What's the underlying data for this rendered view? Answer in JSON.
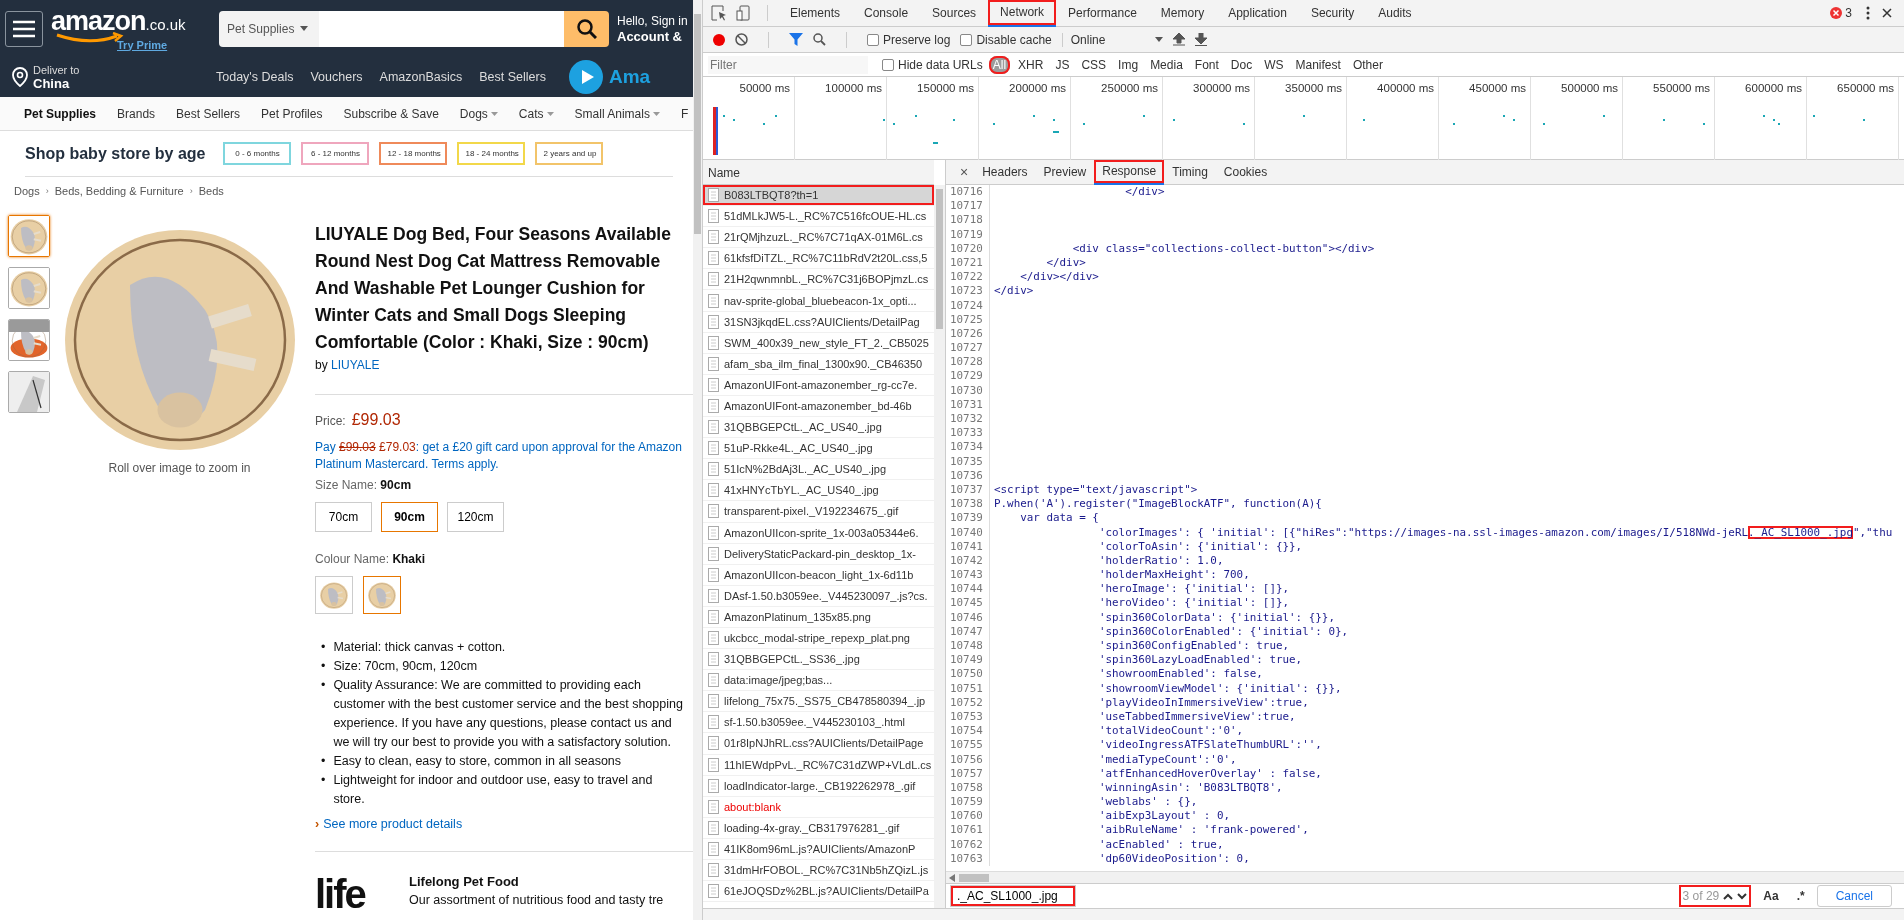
{
  "amazon": {
    "header": {
      "logo": "amazon",
      "logo_suffix": ".co.uk",
      "try_prime": "Try Prime",
      "search_category": "Pet Supplies",
      "greeting": "Hello, Sign in",
      "account": "Account &"
    },
    "deliver": {
      "label": "Deliver to",
      "location": "China"
    },
    "nav_links": [
      "Today's Deals",
      "Vouchers",
      "AmazonBasics",
      "Best Sellers"
    ],
    "prime_text": "Ama",
    "subnav": [
      {
        "label": "Pet Supplies",
        "bold": true,
        "dropdown": false
      },
      {
        "label": "Brands",
        "bold": false,
        "dropdown": false
      },
      {
        "label": "Best Sellers",
        "bold": false,
        "dropdown": false
      },
      {
        "label": "Pet Profiles",
        "bold": false,
        "dropdown": false
      },
      {
        "label": "Subscribe & Save",
        "bold": false,
        "dropdown": false
      },
      {
        "label": "Dogs",
        "bold": false,
        "dropdown": true
      },
      {
        "label": "Cats",
        "bold": false,
        "dropdown": true
      },
      {
        "label": "Small Animals",
        "bold": false,
        "dropdown": true
      },
      {
        "label": "F",
        "bold": false,
        "dropdown": false
      }
    ],
    "baby_store": {
      "title": "Shop baby store by age",
      "ages": [
        {
          "label": "0 - 6 months",
          "color": "#7fd6de"
        },
        {
          "label": "6 - 12 months",
          "color": "#efa6bd"
        },
        {
          "label": "12 - 18  months",
          "color": "#ef8a5a"
        },
        {
          "label": "18 - 24 months",
          "color": "#f2d84a"
        },
        {
          "label": "2 years and up",
          "color": "#f2c46a"
        }
      ]
    },
    "breadcrumbs": [
      {
        "label": "Dogs"
      },
      {
        "separator": "›",
        "label": "Beds, Bedding & Furniture"
      },
      {
        "separator": "›",
        "label": "Beds"
      }
    ],
    "thumbnails": [
      {
        "selected": true
      },
      {
        "selected": false
      },
      {
        "selected": false
      },
      {
        "selected": false
      }
    ],
    "zoom_hint": "Roll over image to zoom in",
    "product": {
      "title": "LIUYALE Dog Bed, Four Seasons Available Round Nest Dog Cat Mattress Removable And Washable Pet Lounger Cushion for Winter Cats and Small Dogs Sleeping Comfortable (Color : Khaki, Size : 90cm)",
      "by": "by",
      "brand": "LIUYALE",
      "price_label": "Price:",
      "price": "£99.03",
      "offer_prefix": "Pay",
      "offer_was": "£99.03",
      "offer_now": "£79.03",
      "offer_text": ": get a £20 gift card upon approval for the Amazon Platinum Mastercard. Terms apply.",
      "size_label": "Size Name:",
      "size_value": "90cm",
      "sizes": [
        {
          "label": "70cm",
          "selected": false
        },
        {
          "label": "90cm",
          "selected": true
        },
        {
          "label": "120cm",
          "selected": false
        }
      ],
      "colour_label": "Colour Name:",
      "colour_value": "Khaki",
      "colour_swatches": [
        {
          "selected": false
        },
        {
          "selected": true
        }
      ],
      "bullets": [
        {
          "marker": "•",
          "text": "Material: thick canvas + cotton."
        },
        {
          "marker": "•",
          "text": "Size: 70cm, 90cm, 120cm"
        },
        {
          "marker": "•",
          "text": "Quality Assurance: We are committed to providing each customer with the best customer service and the best shopping experience. If you have any questions, please contact us and we will try our best to provide you with a satisfactory solution."
        },
        {
          "marker": "•",
          "text": "Easy to clean, easy to store, common in all seasons"
        },
        {
          "marker": "•",
          "text": "Lightweight for indoor and outdoor use, easy to travel and store."
        }
      ],
      "see_more_marker": "›",
      "see_more": "See more product details"
    },
    "brand_card": {
      "logo": "life",
      "title": "Lifelong Pet Food",
      "text": "Our assortment of nutritious food and tasty tre"
    }
  },
  "devtools": {
    "tabs": [
      {
        "label": "Elements",
        "selected": false,
        "highlighted": false
      },
      {
        "label": "Console",
        "selected": false,
        "highlighted": false
      },
      {
        "label": "Sources",
        "selected": false,
        "highlighted": false
      },
      {
        "label": "Network",
        "selected": true,
        "highlighted": true
      },
      {
        "label": "Performance",
        "selected": false,
        "highlighted": false
      },
      {
        "label": "Memory",
        "selected": false,
        "highlighted": false
      },
      {
        "label": "Application",
        "selected": false,
        "highlighted": false
      },
      {
        "label": "Security",
        "selected": false,
        "highlighted": false
      },
      {
        "label": "Audits",
        "selected": false,
        "highlighted": false
      }
    ],
    "error_count": "3",
    "toolbar": {
      "recording": true,
      "options": [
        {
          "label": "Preserve log",
          "checked": false
        },
        {
          "label": "Disable cache",
          "checked": false
        }
      ],
      "throttle": "Online"
    },
    "filter": {
      "placeholder": "Filter",
      "hide_data_urls": {
        "label": "Hide data URLs",
        "checked": false
      },
      "types": [
        {
          "label": "All",
          "selected": true,
          "highlighted": true
        },
        {
          "label": "XHR",
          "selected": false,
          "highlighted": false
        },
        {
          "label": "JS",
          "selected": false,
          "highlighted": false
        },
        {
          "label": "CSS",
          "selected": false,
          "highlighted": false
        },
        {
          "label": "Img",
          "selected": false,
          "highlighted": false
        },
        {
          "label": "Media",
          "selected": false,
          "highlighted": false
        },
        {
          "label": "Font",
          "selected": false,
          "highlighted": false
        },
        {
          "label": "Doc",
          "selected": false,
          "highlighted": false
        },
        {
          "label": "WS",
          "selected": false,
          "highlighted": false
        },
        {
          "label": "Manifest",
          "selected": false,
          "highlighted": false
        },
        {
          "label": "Other",
          "selected": false,
          "highlighted": false
        }
      ]
    },
    "timeline_ticks": [
      "50000 ms",
      "100000 ms",
      "150000 ms",
      "200000 ms",
      "250000 ms",
      "300000 ms",
      "350000 ms",
      "400000 ms",
      "450000 ms",
      "500000 ms",
      "550000 ms",
      "600000 ms",
      "650000 ms"
    ],
    "requests_header": "Name",
    "requests": [
      {
        "name": "B083LTBQT8?th=1",
        "selected": true,
        "error": false,
        "highlighted": true
      },
      {
        "name": "51dMLkJW5-L._RC%7C516fcOUE-HL.cs",
        "selected": false,
        "error": false,
        "highlighted": false
      },
      {
        "name": "21rQMjhzuzL._RC%7C71qAX-01M6L.cs",
        "selected": false,
        "error": false,
        "highlighted": false
      },
      {
        "name": "61kfsfDiTZL._RC%7C11bRdV2t20L.css,5",
        "selected": false,
        "error": false,
        "highlighted": false
      },
      {
        "name": "21H2qwnmnbL._RC%7C31j6BOPjmzL.cs",
        "selected": false,
        "error": false,
        "highlighted": false
      },
      {
        "name": "nav-sprite-global_bluebeacon-1x_opti...",
        "selected": false,
        "error": false,
        "highlighted": false
      },
      {
        "name": "31SN3jkqdEL.css?AUIClients/DetailPag",
        "selected": false,
        "error": false,
        "highlighted": false
      },
      {
        "name": "SWM_400x39_new_style_FT_2._CB5025",
        "selected": false,
        "error": false,
        "highlighted": false
      },
      {
        "name": "afam_sba_ilm_final_1300x90._CB46350",
        "selected": false,
        "error": false,
        "highlighted": false
      },
      {
        "name": "AmazonUIFont-amazonember_rg-cc7e.",
        "selected": false,
        "error": false,
        "highlighted": false
      },
      {
        "name": "AmazonUIFont-amazonember_bd-46b",
        "selected": false,
        "error": false,
        "highlighted": false
      },
      {
        "name": "31QBBGEPCtL._AC_US40_.jpg",
        "selected": false,
        "error": false,
        "highlighted": false
      },
      {
        "name": "51uP-Rkke4L._AC_US40_.jpg",
        "selected": false,
        "error": false,
        "highlighted": false
      },
      {
        "name": "51IcN%2BdAj3L._AC_US40_.jpg",
        "selected": false,
        "error": false,
        "highlighted": false
      },
      {
        "name": "41xHNYcTbYL._AC_US40_.jpg",
        "selected": false,
        "error": false,
        "highlighted": false
      },
      {
        "name": "transparent-pixel._V192234675_.gif",
        "selected": false,
        "error": false,
        "highlighted": false
      },
      {
        "name": "AmazonUIIcon-sprite_1x-003a05344e6.",
        "selected": false,
        "error": false,
        "highlighted": false
      },
      {
        "name": "DeliveryStaticPackard-pin_desktop_1x-",
        "selected": false,
        "error": false,
        "highlighted": false
      },
      {
        "name": "AmazonUIIcon-beacon_light_1x-6d11b",
        "selected": false,
        "error": false,
        "highlighted": false
      },
      {
        "name": "DAsf-1.50.b3059ee._V445230097_.js?cs.",
        "selected": false,
        "error": false,
        "highlighted": false
      },
      {
        "name": "AmazonPlatinum_135x85.png",
        "selected": false,
        "error": false,
        "highlighted": false
      },
      {
        "name": "ukcbcc_modal-stripe_repexp_plat.png",
        "selected": false,
        "error": false,
        "highlighted": false
      },
      {
        "name": "31QBBGEPCtL._SS36_.jpg",
        "selected": false,
        "error": false,
        "highlighted": false
      },
      {
        "name": "data:image/jpeg;bas...",
        "selected": false,
        "error": false,
        "highlighted": false
      },
      {
        "name": "lifelong_75x75._SS75_CB478580394_.jp",
        "selected": false,
        "error": false,
        "highlighted": false
      },
      {
        "name": "sf-1.50.b3059ee._V445230103_.html",
        "selected": false,
        "error": false,
        "highlighted": false
      },
      {
        "name": "01r8IpNJhRL.css?AUIClients/DetailPage",
        "selected": false,
        "error": false,
        "highlighted": false
      },
      {
        "name": "11hIEWdpPvL._RC%7C31dZWP+VLdL.cs",
        "selected": false,
        "error": false,
        "highlighted": false
      },
      {
        "name": "loadIndicator-large._CB192262978_.gif",
        "selected": false,
        "error": false,
        "highlighted": false
      },
      {
        "name": "about:blank",
        "selected": false,
        "error": true,
        "highlighted": false
      },
      {
        "name": "loading-4x-gray._CB317976281_.gif",
        "selected": false,
        "error": false,
        "highlighted": false
      },
      {
        "name": "41IK8om96mL.js?AUIClients/AmazonP",
        "selected": false,
        "error": false,
        "highlighted": false
      },
      {
        "name": "31dmHrFOBOL._RC%7C31Nb5hZQizL.js",
        "selected": false,
        "error": false,
        "highlighted": false
      },
      {
        "name": "61eJOQSDz%2BL.js?AUIClients/DetailPa",
        "selected": false,
        "error": false,
        "highlighted": false
      }
    ],
    "detail_tabs": [
      {
        "label": "Headers",
        "selected": false,
        "highlighted": false
      },
      {
        "label": "Preview",
        "selected": false,
        "highlighted": false
      },
      {
        "label": "Response",
        "selected": true,
        "highlighted": true
      },
      {
        "label": "Timing",
        "selected": false,
        "highlighted": false
      },
      {
        "label": "Cookies",
        "selected": false,
        "highlighted": false
      }
    ],
    "close": "×",
    "code_lines": [
      {
        "number": "10716",
        "text": "                    </div>"
      },
      {
        "number": "10717"
      },
      {
        "number": "10718"
      },
      {
        "number": "10719"
      },
      {
        "number": "10720",
        "text": "            <div class=\"collections-collect-button\"></div>"
      },
      {
        "number": "10721",
        "text": "        </div>"
      },
      {
        "number": "10722",
        "text": "    </div></div>"
      },
      {
        "number": "10723",
        "text": "</div>"
      },
      {
        "number": "10724"
      },
      {
        "number": "10725"
      },
      {
        "number": "10726"
      },
      {
        "number": "10727"
      },
      {
        "number": "10728"
      },
      {
        "number": "10729"
      },
      {
        "number": "10730"
      },
      {
        "number": "10731"
      },
      {
        "number": "10732"
      },
      {
        "number": "10733"
      },
      {
        "number": "10734"
      },
      {
        "number": "10735"
      },
      {
        "number": "10736"
      },
      {
        "number": "10737",
        "text": "<script type=\"text/javascript\">"
      },
      {
        "number": "10738",
        "text": "P.when('A').register(\"ImageBlockATF\", function(A){"
      },
      {
        "number": "10739",
        "text": "    var data = {"
      },
      {
        "number": "10740",
        "text": "                'colorImages': { 'initial': [{\"hiRes\":\"https://images-na.ssl-images-amazon.com/images/I/518NWd-jeRL",
        "match": "._AC_SL1000_.jpg",
        "after": "\",\"thu"
      },
      {
        "number": "10741",
        "text": "                'colorToAsin': {'initial': {}},"
      },
      {
        "number": "10742",
        "text": "                'holderRatio': 1.0,"
      },
      {
        "number": "10743",
        "text": "                'holderMaxHeight': 700,"
      },
      {
        "number": "10744",
        "text": "                'heroImage': {'initial': []},"
      },
      {
        "number": "10745",
        "text": "                'heroVideo': {'initial': []},"
      },
      {
        "number": "10746",
        "text": "                'spin360ColorData': {'initial': {}},"
      },
      {
        "number": "10747",
        "text": "                'spin360ColorEnabled': {'initial': 0},"
      },
      {
        "number": "10748",
        "text": "                'spin360ConfigEnabled': true,"
      },
      {
        "number": "10749",
        "text": "                'spin360LazyLoadEnabled': true,"
      },
      {
        "number": "10750",
        "text": "                'showroomEnabled': false,"
      },
      {
        "number": "10751",
        "text": "                'showroomViewModel': {'initial': {}},"
      },
      {
        "number": "10752",
        "text": "                'playVideoInImmersiveView':true,"
      },
      {
        "number": "10753",
        "text": "                'useTabbedImmersiveView':true,"
      },
      {
        "number": "10754",
        "text": "                'totalVideoCount':'0',"
      },
      {
        "number": "10755",
        "text": "                'videoIngressATFSlateThumbURL':'',"
      },
      {
        "number": "10756",
        "text": "                'mediaTypeCount':'0',"
      },
      {
        "number": "10757",
        "text": "                'atfEnhancedHoverOverlay' : false,"
      },
      {
        "number": "10758",
        "text": "                'winningAsin': 'B083LTBQT8',"
      },
      {
        "number": "10759",
        "text": "                'weblabs' : {},"
      },
      {
        "number": "10760",
        "text": "                'aibExp3Layout' : 0,"
      },
      {
        "number": "10761",
        "text": "                'aibRuleName' : 'frank-powered',"
      },
      {
        "number": "10762",
        "text": "                'acEnabled' : true,"
      },
      {
        "number": "10763",
        "text": "                'dp60VideoPosition': 0,"
      }
    ],
    "search": {
      "value": "._AC_SL1000_.jpg",
      "highlighted": true,
      "match_count": "3 of 29",
      "count_highlighted": true,
      "case_toggle": "Aa",
      "regex_toggle": ".*",
      "cancel": "Cancel"
    }
  }
}
